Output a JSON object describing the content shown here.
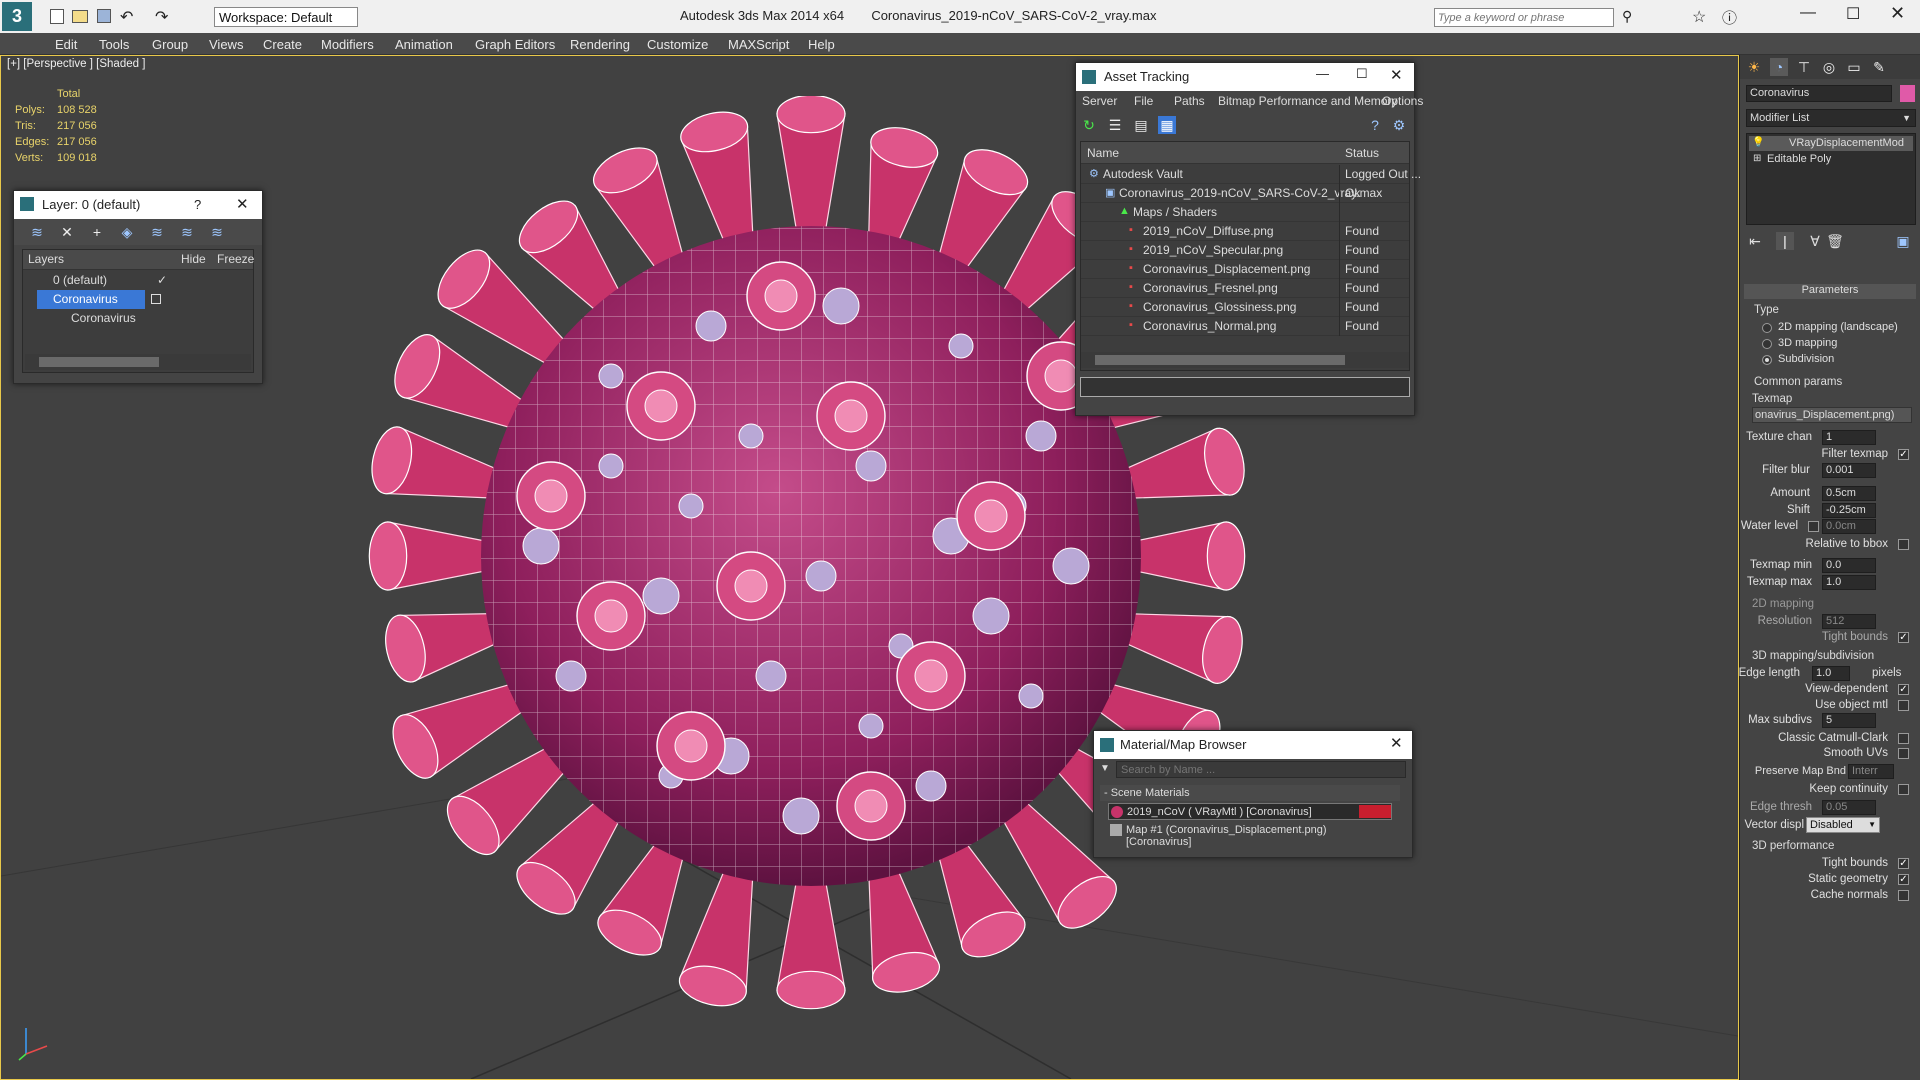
{
  "app": {
    "title": "Autodesk 3ds Max  2014 x64",
    "file": "Coronavirus_2019-nCoV_SARS-CoV-2_vray.max",
    "workspace": "Workspace: Default",
    "search_placeholder": "Type a keyword or phrase"
  },
  "menu": [
    "Edit",
    "Tools",
    "Group",
    "Views",
    "Create",
    "Modifiers",
    "Animation",
    "Graph Editors",
    "Rendering",
    "Customize",
    "MAXScript",
    "Help"
  ],
  "viewport": {
    "label": "[+] [Perspective ] [Shaded ]",
    "stats": {
      "header": "Total",
      "rows": [
        {
          "label": "Polys:",
          "value": "108 528"
        },
        {
          "label": "Tris:",
          "value": "217 056"
        },
        {
          "label": "Edges:",
          "value": "217 056"
        },
        {
          "label": "Verts:",
          "value": "109 018"
        }
      ]
    }
  },
  "layer_window": {
    "title": "Layer: 0 (default)",
    "help": "?",
    "columns": [
      "Layers",
      "Hide",
      "Freeze"
    ],
    "rows": [
      {
        "name": "0 (default)",
        "check": "✓"
      },
      {
        "name": "Coronavirus"
      },
      {
        "name": "Coronavirus"
      }
    ]
  },
  "asset_window": {
    "title": "Asset Tracking",
    "menu": [
      "Server",
      "File",
      "Paths",
      "Bitmap Performance and Memory",
      "Options"
    ],
    "columns": [
      "Name",
      "Status"
    ],
    "rows": [
      {
        "name": "Autodesk Vault",
        "status": "Logged Out ..."
      },
      {
        "name": "Coronavirus_2019-nCoV_SARS-CoV-2_vray.max",
        "status": "Ok"
      },
      {
        "name": "Maps / Shaders",
        "status": ""
      },
      {
        "name": "2019_nCoV_Diffuse.png",
        "status": "Found"
      },
      {
        "name": "2019_nCoV_Specular.png",
        "status": "Found"
      },
      {
        "name": "Coronavirus_Displacement.png",
        "status": "Found"
      },
      {
        "name": "Coronavirus_Fresnel.png",
        "status": "Found"
      },
      {
        "name": "Coronavirus_Glossiness.png",
        "status": "Found"
      },
      {
        "name": "Coronavirus_Normal.png",
        "status": "Found"
      }
    ]
  },
  "material_window": {
    "title": "Material/Map Browser",
    "search_placeholder": "Search by Name ...",
    "section": "- Scene Materials",
    "items": [
      "2019_nCoV  ( VRayMtl )  [Coronavirus]",
      "Map #1 (Coronavirus_Displacement.png) [Coronavirus]"
    ]
  },
  "command_panel": {
    "object_name": "Coronavirus",
    "modifier_list": "Modifier List",
    "stack": [
      "VRayDisplacementMod",
      "Editable Poly"
    ],
    "rollout": "Parameters",
    "type_label": "Type",
    "types": [
      "2D mapping (landscape)",
      "3D mapping",
      "Subdivision"
    ],
    "common": "Common params",
    "texmap_label": "Texmap",
    "texmap_value": "onavirus_Displacement.png)",
    "fields": [
      {
        "label": "Texture chan",
        "value": "1"
      },
      {
        "label": "Filter texmap",
        "check": "✓"
      },
      {
        "label": "Filter blur",
        "value": "0.001"
      },
      {
        "label": "Amount",
        "value": "0.5cm"
      },
      {
        "label": "Shift",
        "value": "-0.25cm"
      },
      {
        "label": "Water level",
        "value": "0.0cm"
      },
      {
        "label": "Relative to bbox",
        "check": ""
      },
      {
        "label": "Texmap min",
        "value": "0.0"
      },
      {
        "label": "Texmap max",
        "value": "1.0"
      }
    ],
    "section_2d": "2D mapping",
    "resolution_label": "Resolution",
    "resolution": "512",
    "tight_bounds_label": "Tight bounds",
    "section_3d": "3D mapping/subdivision",
    "edge_length_label": "Edge length",
    "edge_length": "1.0",
    "pixels": "pixels",
    "view_dependent": "View-dependent",
    "use_object_mtl": "Use object mtl",
    "max_subdivs_label": "Max subdivs",
    "max_subdivs": "5",
    "catmull": "Classic Catmull-Clark",
    "smooth_uvs": "Smooth UVs",
    "preserve_label": "Preserve Map Bnd",
    "preserve_value": "Interr",
    "keep_continuity": "Keep continuity",
    "edge_thresh_label": "Edge thresh",
    "edge_thresh": "0.05",
    "vector_label": "Vector displ",
    "vector_value": "Disabled",
    "section_perf": "3D performance",
    "perf": [
      "Tight bounds",
      "Static geometry",
      "Cache normals"
    ]
  },
  "colors": {
    "accent": "#e8c84a",
    "virus": "#c8336a",
    "selection": "#3a78d6",
    "object_swatch": "#e05aa8"
  }
}
